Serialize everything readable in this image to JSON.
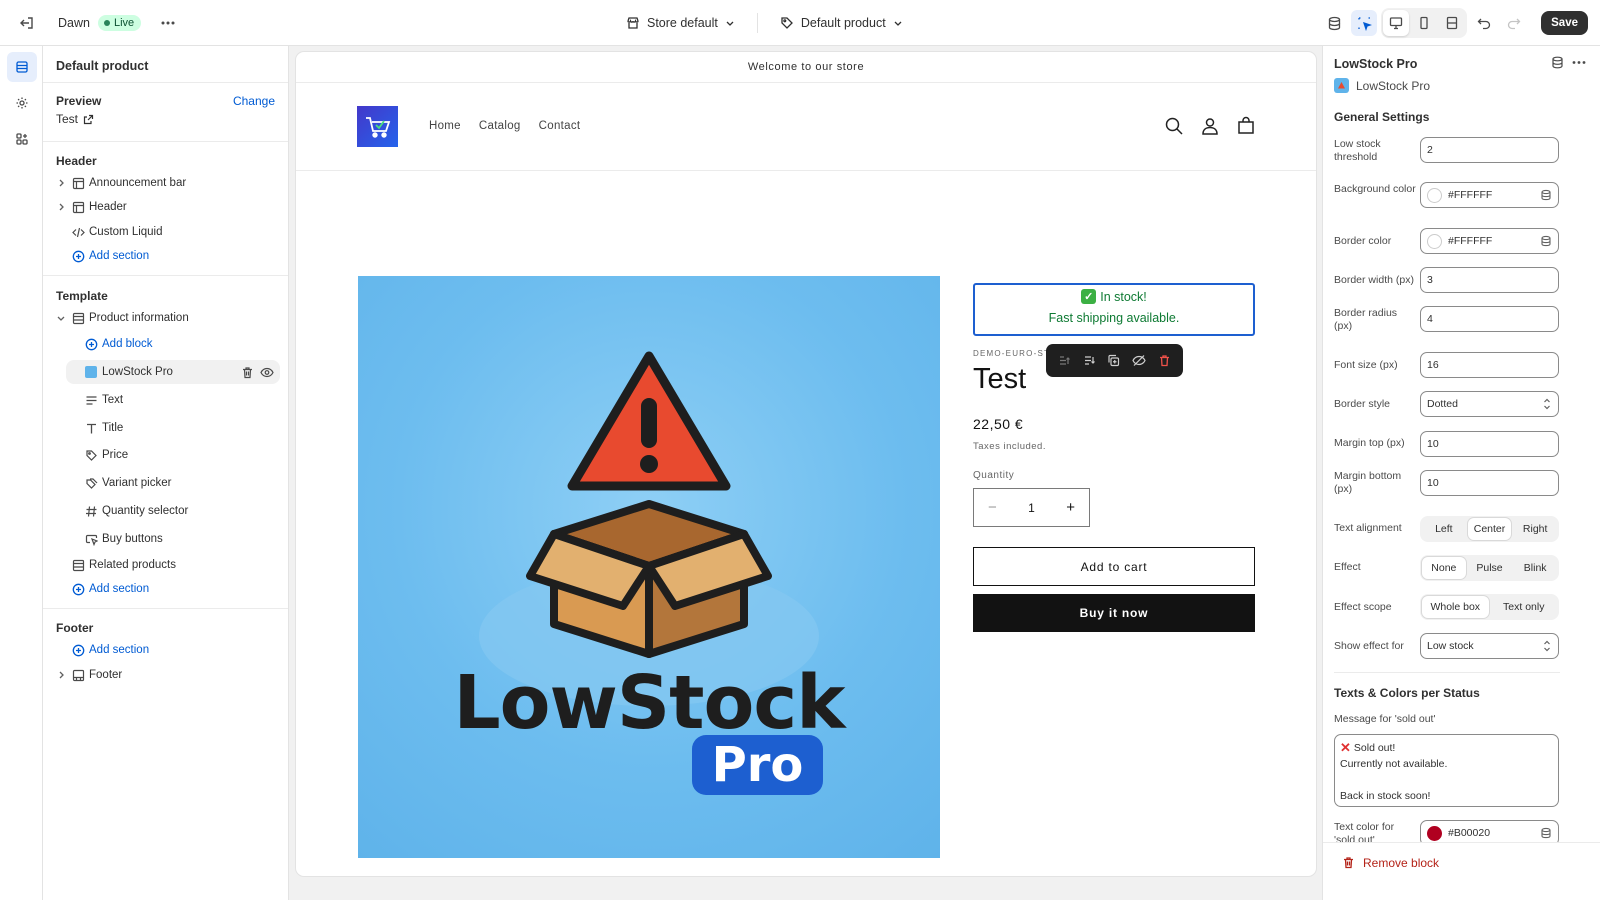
{
  "topbar": {
    "theme_name": "Dawn",
    "live_badge": "Live",
    "store_select": "Store default",
    "template_select": "Default product",
    "save_label": "Save"
  },
  "left_panel": {
    "title": "Default product",
    "preview_label": "Preview",
    "change_link": "Change",
    "preview_value": "Test",
    "header_heading": "Header",
    "header_items": [
      "Announcement bar",
      "Header",
      "Custom Liquid"
    ],
    "add_section": "Add section",
    "template_heading": "Template",
    "product_info": "Product information",
    "add_block": "Add block",
    "blocks": [
      "LowStock Pro",
      "Text",
      "Title",
      "Price",
      "Variant picker",
      "Quantity selector",
      "Buy buttons"
    ],
    "related_products": "Related products",
    "footer_heading": "Footer",
    "footer_item": "Footer"
  },
  "store": {
    "announcement": "Welcome to our store",
    "nav": [
      "Home",
      "Catalog",
      "Contact"
    ],
    "image_wordmark": "LowStock",
    "image_pill": "Pro",
    "stock_line1": "In stock!",
    "stock_line2": "Fast shipping available.",
    "vendor": "DEMO-EURO-STO",
    "product_title": "Test",
    "price": "22,50 €",
    "tax_note": "Taxes included.",
    "quantity_label": "Quantity",
    "quantity_value": "1",
    "add_to_cart": "Add to cart",
    "buy_now": "Buy it now"
  },
  "right_panel": {
    "title": "LowStock Pro",
    "app_name": "LowStock Pro",
    "general_heading": "General Settings",
    "fields": {
      "low_stock_threshold": {
        "label": "Low stock threshold",
        "value": "2"
      },
      "background_color": {
        "label": "Background color",
        "value": "#FFFFFF"
      },
      "border_color": {
        "label": "Border color",
        "value": "#FFFFFF"
      },
      "border_width": {
        "label": "Border width (px)",
        "value": "3"
      },
      "border_radius": {
        "label": "Border radius (px)",
        "value": "4"
      },
      "font_size": {
        "label": "Font size (px)",
        "value": "16"
      },
      "border_style": {
        "label": "Border style",
        "value": "Dotted"
      },
      "margin_top": {
        "label": "Margin top (px)",
        "value": "10"
      },
      "margin_bottom": {
        "label": "Margin bottom (px)",
        "value": "10"
      },
      "show_effect_for": {
        "label": "Show effect for",
        "value": "Low stock"
      }
    },
    "text_alignment": {
      "label": "Text alignment",
      "options": [
        "Left",
        "Center",
        "Right"
      ],
      "selected": "Center"
    },
    "effect": {
      "label": "Effect",
      "options": [
        "None",
        "Pulse",
        "Blink"
      ],
      "selected": "None"
    },
    "effect_scope": {
      "label": "Effect scope",
      "options": [
        "Whole box",
        "Text only"
      ],
      "selected": "Whole box"
    },
    "texts_heading": "Texts & Colors per Status",
    "sold_out_message_label": "Message for 'sold out'",
    "sold_out_message_lines": [
      "Sold out!",
      "Currently not available.",
      "",
      "Back in stock soon!"
    ],
    "sold_out_color_label": "Text color for 'sold out'",
    "sold_out_color_value": "#B00020",
    "remove_block": "Remove block"
  },
  "colors": {
    "accent": "#005bd3",
    "live_bg": "#cdfee1",
    "stock_border": "#1d5fd0",
    "stock_text": "#0e7a33",
    "sold_out_color": "#B00020",
    "danger": "#b42318"
  },
  "icons": [
    "exit-icon",
    "more-icon",
    "store-icon",
    "tag-icon",
    "chevron-down-icon",
    "database-icon",
    "inspector-icon",
    "desktop-icon",
    "mobile-icon",
    "fullwidth-icon",
    "undo-icon",
    "redo-icon",
    "sections-icon",
    "settings-icon",
    "apps-icon",
    "external-link-icon",
    "trash-icon",
    "eye-icon",
    "search-icon",
    "account-icon",
    "cart-icon"
  ]
}
